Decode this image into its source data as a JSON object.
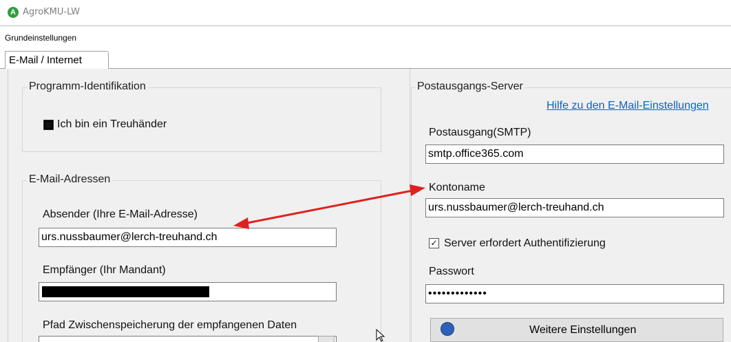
{
  "window": {
    "title": "AgroKMU-LW",
    "icon": "app-logo-icon"
  },
  "menu": {
    "items": [
      "Grundeinstellungen"
    ]
  },
  "tabs": [
    {
      "label": "E-Mail / Internet",
      "active": true
    }
  ],
  "program_id": {
    "title": "Programm-Identifikation",
    "checkbox_label": "Ich bin ein Treuhänder"
  },
  "email_addresses": {
    "title": "E-Mail-Adressen",
    "sender_label": "Absender (Ihre E-Mail-Adresse)",
    "sender_value": "urs.nussbaumer@lerch-treuhand.ch",
    "recipient_label": "Empfänger  (Ihr Mandant)",
    "path_label": "Pfad Zwischenspeicherung der empfangenen Daten"
  },
  "outgoing_server": {
    "title": "Postausgangs-Server",
    "help_link": "Hilfe zu den E-Mail-Einstellungen",
    "smtp_label": "Postausgang(SMTP)",
    "smtp_value": "smtp.office365.com",
    "account_label": "Kontoname",
    "account_value": "urs.nussbaumer@lerch-treuhand.ch",
    "auth_label": "Server erfordert Authentifizierung",
    "auth_checked": true,
    "password_label": "Passwort",
    "password_value": "•••••••••••••",
    "more_settings_button": "Weitere Einstellungen"
  },
  "colors": {
    "annotation_arrow": "#e02020",
    "link": "#0066cc",
    "panel": "#f0f0f0"
  }
}
